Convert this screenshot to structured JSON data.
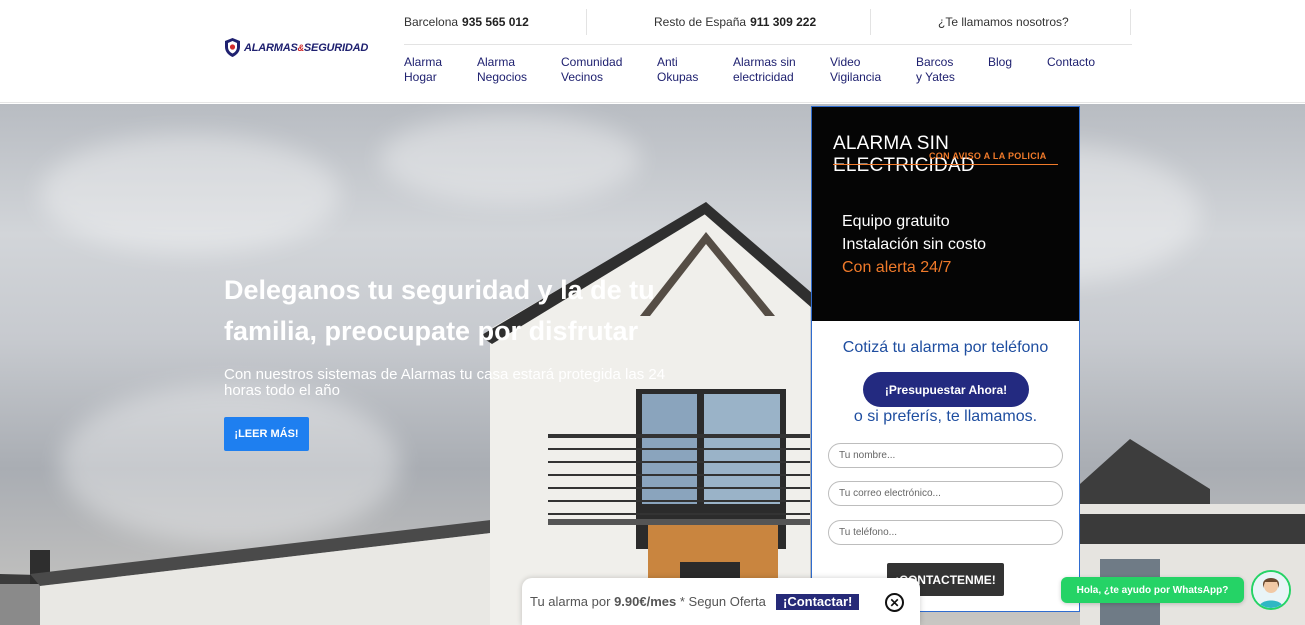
{
  "header": {
    "logo_text_1": "ALARMAS",
    "logo_amp": "&",
    "logo_text_2": "SEGURIDAD",
    "topbar": {
      "barcelona_label": "Barcelona",
      "barcelona_phone": "935 565 012",
      "spain_label": "Resto de España",
      "spain_phone": "911 309 222",
      "callback": "¿Te llamamos nosotros?"
    },
    "nav": [
      {
        "line1": "Alarma",
        "line2": "Hogar"
      },
      {
        "line1": "Alarma",
        "line2": "Negocios"
      },
      {
        "line1": "Comunidad",
        "line2": "Vecinos"
      },
      {
        "line1": "Anti",
        "line2": "Okupas"
      },
      {
        "line1": "Alarmas sin",
        "line2": "electricidad"
      },
      {
        "line1": "Video",
        "line2": "Vigilancia"
      },
      {
        "line1": "Barcos",
        "line2": "y Yates"
      },
      {
        "line1": "Blog",
        "line2": ""
      },
      {
        "line1": "Contacto",
        "line2": ""
      }
    ]
  },
  "hero": {
    "title": "Deleganos tu seguridad y la de tu familia, preocupate por disfrutar",
    "subtitle": "Con nuestros sistemas de Alarmas tu casa estará protegida las 24 horas todo el año",
    "button": "¡LEER MÁS!"
  },
  "panel": {
    "banner_title": "ALARMA SIN ELECTRICIDAD",
    "banner_sub": "CON AVISO A LA POLICIA",
    "banner_line1": "Equipo gratuito",
    "banner_line2": "Instalación sin costo",
    "banner_line3": "Con alerta 24/7",
    "question": "Cotizá tu alarma por teléfono",
    "cta": "¡Presupuestar Ahora!",
    "alt": "o si preferís, te llamamos.",
    "name_placeholder": "Tu nombre...",
    "email_placeholder": "Tu correo electrónico...",
    "phone_placeholder": "Tu teléfono...",
    "submit": "¡CONTACTENME!"
  },
  "offer": {
    "prefix": "Tu alarma por",
    "price": "9.90€/mes",
    "suffix": "* Segun Oferta",
    "link": "¡Contactar!",
    "close": "✕"
  },
  "whatsapp": {
    "bubble": "Hola, ¿te ayudo por WhatsApp?"
  },
  "colors": {
    "brand_navy": "#1f2170",
    "accent_blue": "#1e7ff0",
    "orange": "#f07a2a",
    "whatsapp_green": "#25d366"
  }
}
